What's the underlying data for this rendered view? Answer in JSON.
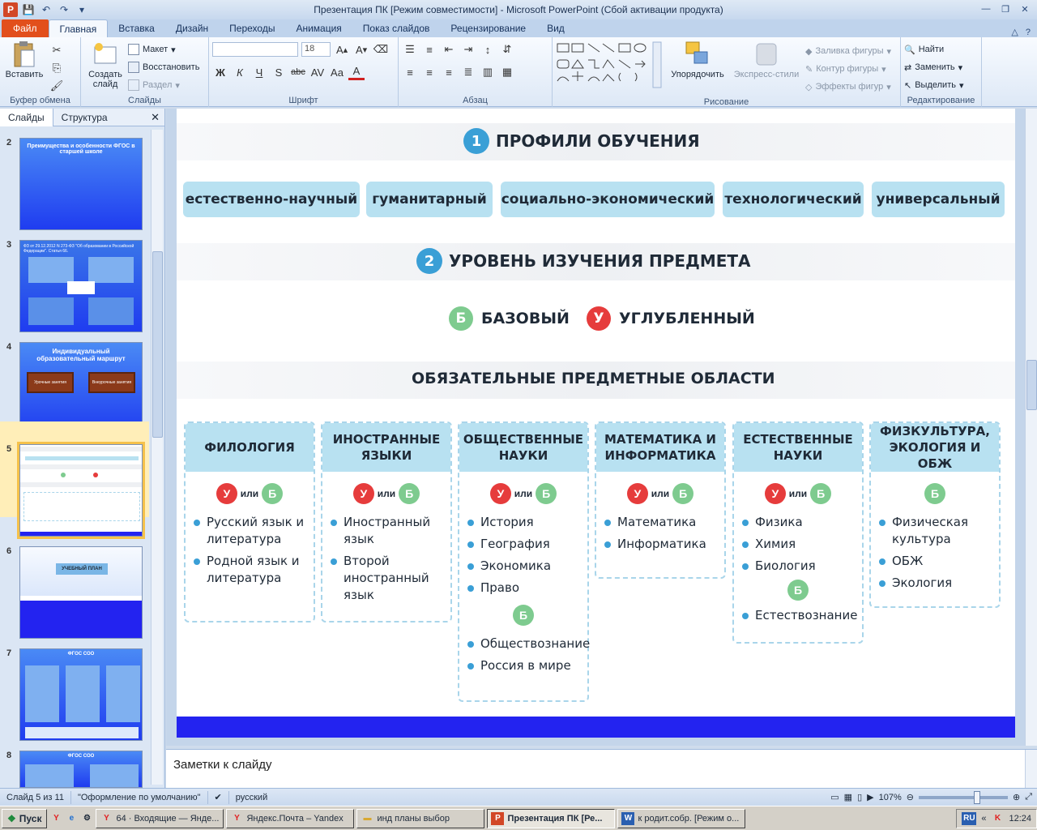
{
  "window": {
    "title": "Презентация ПК [Режим совместимости]  -  Microsoft PowerPoint (Сбой активации продукта)"
  },
  "ribbon": {
    "tabs": [
      "Файл",
      "Главная",
      "Вставка",
      "Дизайн",
      "Переходы",
      "Анимация",
      "Показ слайдов",
      "Рецензирование",
      "Вид"
    ],
    "clipboard": {
      "paste": "Вставить",
      "label": "Буфер обмена"
    },
    "slides": {
      "new_slide": "Создать слайд",
      "layout": "Макет",
      "reset": "Восстановить",
      "section": "Раздел",
      "label": "Слайды"
    },
    "font": {
      "size": "18",
      "label": "Шрифт",
      "bold": "Ж",
      "italic": "К",
      "underline": "Ч",
      "shadow": "S",
      "strike": "abc"
    },
    "paragraph": {
      "label": "Абзац"
    },
    "drawing": {
      "arrange": "Упорядочить",
      "quick_styles": "Экспресс-стили",
      "fill": "Заливка фигуры",
      "outline": "Контур фигуры",
      "effects": "Эффекты фигур",
      "label": "Рисование"
    },
    "editing": {
      "find": "Найти",
      "replace": "Заменить",
      "select": "Выделить",
      "label": "Редактирование"
    }
  },
  "panel": {
    "tabs": [
      "Слайды",
      "Структура"
    ],
    "thumbnails": [
      {
        "num": "2",
        "title": "Преимущества и особенности ФГОС в старшей школе"
      },
      {
        "num": "3",
        "title": "ФЗ от 29.12.2012 N 273-ФЗ \"Об образовании в Российской Федерации\". Статья 66."
      },
      {
        "num": "4",
        "title": "Индивидуальный образовательный маршрут",
        "btn1": "Урочные занятия",
        "btn2": "Внеурочные занятия"
      },
      {
        "num": "5",
        "title": ""
      },
      {
        "num": "6",
        "title": "УЧЕБНЫЙ ПЛАН"
      },
      {
        "num": "7",
        "title": "ФГОС СОО"
      },
      {
        "num": "8",
        "title": "ФГОС СОО"
      }
    ]
  },
  "slide": {
    "section1": {
      "num": "1",
      "title": "ПРОФИЛИ ОБУЧЕНИЯ"
    },
    "profiles": [
      "естественно-научный",
      "гуманитарный",
      "социально-экономический",
      "технологический",
      "универсальный"
    ],
    "section2": {
      "num": "2",
      "title": "УРОВЕНЬ ИЗУЧЕНИЯ ПРЕДМЕТА"
    },
    "levels": [
      {
        "letter": "Б",
        "label": "БАЗОВЫЙ"
      },
      {
        "letter": "У",
        "label": "УГЛУБЛЕННЫЙ"
      }
    ],
    "areas_title": "ОБЯЗАТЕЛЬНЫЕ ПРЕДМЕТНЫЕ ОБЛАСТИ",
    "or_word": "или",
    "areas": [
      {
        "head": "ФИЛОЛОГИЯ",
        "subjects": [
          "Русский язык и литература",
          "Родной язык и литература"
        ]
      },
      {
        "head": "ИНОСТРАННЫЕ ЯЗЫКИ",
        "subjects": [
          "Иностранный язык",
          "Второй иностранный язык"
        ]
      },
      {
        "head": "ОБЩЕСТВЕННЫЕ НАУКИ",
        "subjects": [
          "История",
          "География",
          "Экономика",
          "Право"
        ],
        "base_subjects": [
          "Обществознание",
          "Россия в мире"
        ]
      },
      {
        "head": "МАТЕМАТИКА И ИНФОРМАТИКА",
        "subjects": [
          "Математика",
          "Информатика"
        ]
      },
      {
        "head": "ЕСТЕСТВЕННЫЕ НАУКИ",
        "subjects": [
          "Физика",
          "Химия",
          "Биология"
        ],
        "base_subjects": [
          "Естествознание"
        ]
      },
      {
        "head": "ФИЗКУЛЬТУРА, ЭКОЛОГИЯ И ОБЖ",
        "subjects": [
          "Физическая культура",
          "ОБЖ",
          "Экология"
        ]
      }
    ]
  },
  "notes": {
    "placeholder": "Заметки к слайду"
  },
  "status": {
    "slide_info": "Слайд 5 из 11",
    "theme": "\"Оформление по умолчанию\"",
    "language": "русский",
    "zoom": "107%"
  },
  "taskbar": {
    "start": "Пуск",
    "items": [
      "64 · Входящие — Янде...",
      "Яндекс.Почта – Yandex",
      "инд планы выбор",
      "Презентация ПК [Ре...",
      "к родит.собр. [Режим о..."
    ],
    "lang": "RU",
    "time": "12:24"
  }
}
